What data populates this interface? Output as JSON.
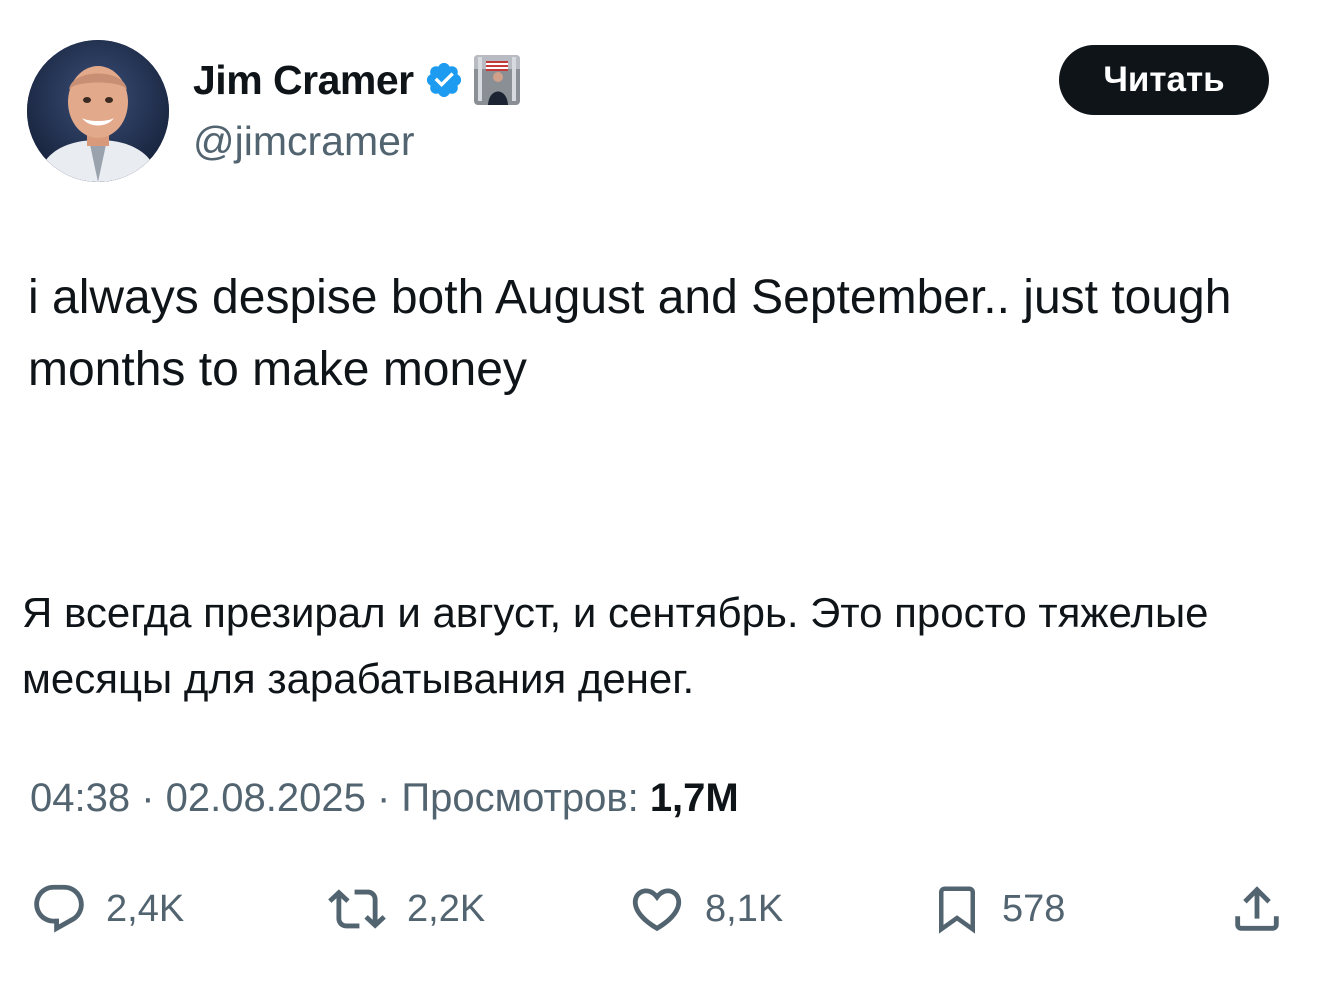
{
  "author": {
    "display_name": "Jim Cramer",
    "handle": "@jimcramer",
    "verified_color": "#1d9bf0"
  },
  "follow_button": {
    "label": "Читать"
  },
  "tweet": {
    "text": "i always despise both August and September.. just tough months to make money",
    "translation": "Я всегда презирал и август, и сентябрь. Это просто тяжелые месяцы для зарабатывания денег."
  },
  "meta": {
    "time": "04:38",
    "separator": " · ",
    "date": "02.08.2025",
    "views_label": "Просмотров: ",
    "views_count": "1,7M"
  },
  "actions": {
    "replies": "2,4K",
    "reposts": "2,2K",
    "likes": "8,1K",
    "bookmarks": "578"
  },
  "icons": {
    "reply": "speech-bubble-icon",
    "repost": "repost-arrows-icon",
    "like": "heart-icon",
    "bookmark": "bookmark-icon",
    "share": "share-upload-icon",
    "verified": "verified-badge-icon"
  }
}
